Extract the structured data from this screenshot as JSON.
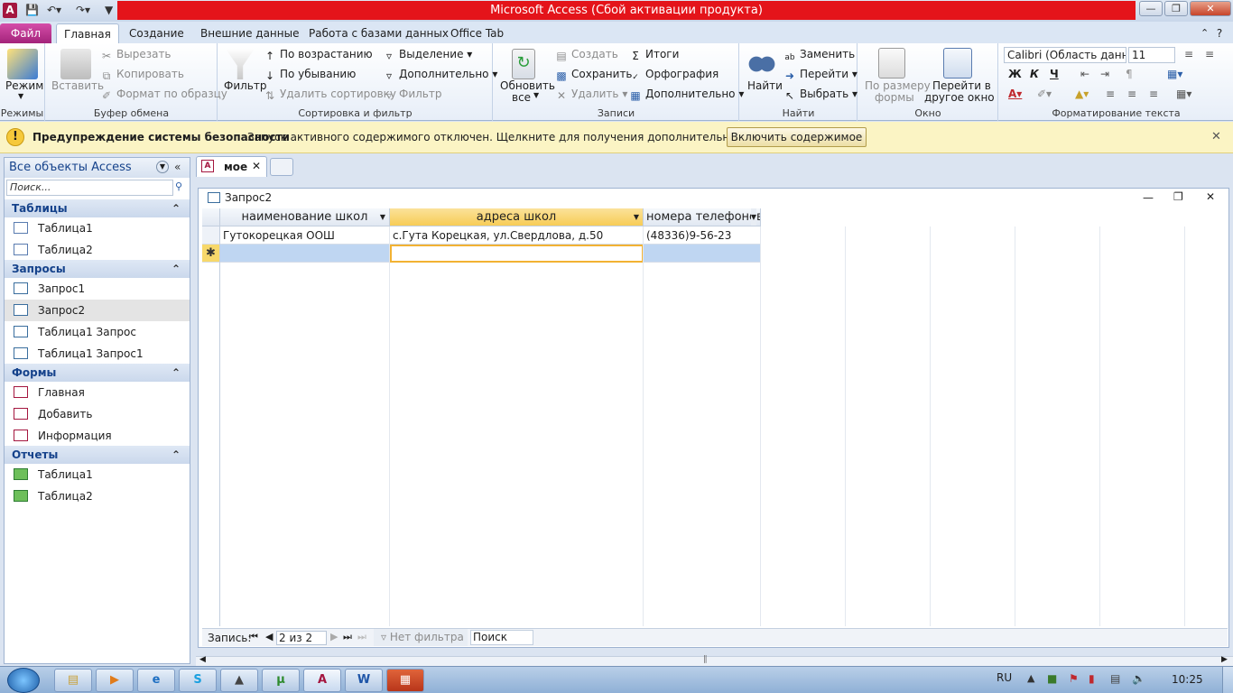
{
  "window": {
    "title": "Microsoft Access (Сбой активации продукта)"
  },
  "ribbon_tabs": [
    "Файл",
    "Главная",
    "Создание",
    "Внешние данные",
    "Работа с базами данных",
    "Office Tab"
  ],
  "ribbon": {
    "modes": {
      "label": "Режимы",
      "view": "Режим"
    },
    "clipboard": {
      "label": "Буфер обмена",
      "paste": "Вставить",
      "cut": "Вырезать",
      "copy": "Копировать",
      "format_painter": "Формат по образцу"
    },
    "sort_filter": {
      "label": "Сортировка и фильтр",
      "filter": "Фильтр",
      "ascending": "По возрастанию",
      "descending": "По убыванию",
      "remove_sort": "Удалить сортировку",
      "selection": "Выделение",
      "advanced": "Дополнительно",
      "toggle_filter": "Фильтр"
    },
    "records": {
      "label": "Записи",
      "refresh": "Обновить",
      "refresh2": "все",
      "new": "Создать",
      "save": "Сохранить",
      "delete": "Удалить",
      "totals": "Итоги",
      "spelling": "Орфография",
      "more": "Дополнительно"
    },
    "find": {
      "label": "Найти",
      "find": "Найти",
      "replace": "Заменить",
      "goto": "Перейти",
      "select": "Выбрать"
    },
    "window": {
      "label": "Окно",
      "fit1": "По размеру",
      "fit2": "формы",
      "switch1": "Перейти в",
      "switch2": "другое окно"
    },
    "text_format": {
      "label": "Форматирование текста",
      "font": "Calibri (Область данных)",
      "size": "11",
      "bold": "Ж",
      "italic": "К",
      "underline": "Ч"
    }
  },
  "security": {
    "title": "Предупреждение системы безопасности",
    "message": "Запуск активного содержимого отключен. Щелкните для получения дополнительных сведений.",
    "button": "Включить содержимое"
  },
  "nav": {
    "header": "Все объекты Access",
    "search_placeholder": "Поиск...",
    "groups": [
      {
        "title": "Таблицы",
        "items": [
          "Таблица1",
          "Таблица2"
        ]
      },
      {
        "title": "Запросы",
        "items": [
          "Запрос1",
          "Запрос2",
          "Таблица1 Запрос",
          "Таблица1 Запрос1"
        ]
      },
      {
        "title": "Формы",
        "items": [
          "Главная",
          "Добавить",
          "Информация"
        ]
      },
      {
        "title": "Отчеты",
        "items": [
          "Таблица1",
          "Таблица2"
        ]
      }
    ]
  },
  "doc_tab": "мое",
  "query_window": {
    "title": "Запрос2"
  },
  "datasheet": {
    "columns": [
      "наименование школ",
      "адреса школ",
      "номера телефонов"
    ],
    "rows": [
      [
        "Гутокорецкая ООШ",
        "с.Гута Корецкая, ул.Свердлова, д.50",
        "(48336)9-56-23"
      ]
    ]
  },
  "record_nav": {
    "label": "Запись:",
    "position": "2 из 2",
    "filter": "Нет фильтра",
    "search": "Поиск"
  },
  "taskbar": {
    "lang": "RU",
    "time": "10:25"
  }
}
